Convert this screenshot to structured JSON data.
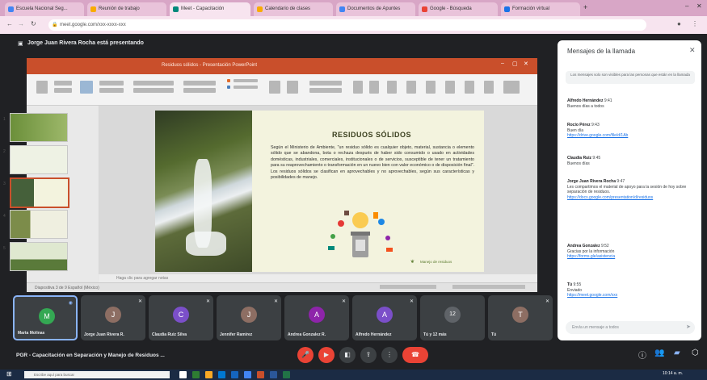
{
  "browser": {
    "tabs": [
      "Escuela Nacional Seg...",
      "Reunión de trabajo",
      "Meet - Capacitación",
      "Calendario de clases",
      "Documentos de Apuntes",
      "Google - Búsqueda",
      "Formación virtual"
    ],
    "url": "meet.google.com/xxx-xxxx-xxx"
  },
  "meet": {
    "presenter_label": "Jorge Juan Rivera Rocha está presentando",
    "meeting_name": "PGR - Capacitación en Separación y Manejo de Residuos ...",
    "participants": [
      {
        "name": "Marta Molinas",
        "initial": "M",
        "color": "#34a853"
      },
      {
        "name": "Jorge Juan Rivera R.",
        "initial": "J",
        "color": "#8d6e63"
      },
      {
        "name": "Claudia Ruiz Silva",
        "initial": "C",
        "color": "#7b4fc9"
      },
      {
        "name": "Jennifer Ramírez",
        "initial": "J",
        "color": "#8d6e63"
      },
      {
        "name": "Andrea Gonzalez R.",
        "initial": "A",
        "color": "#8e24aa"
      },
      {
        "name": "Alfredo Hernández",
        "initial": "A",
        "color": "#7b4fc9"
      },
      {
        "name": "Tú y 12 más",
        "initial": "12",
        "color": "#5f6368"
      },
      {
        "name": "Tú",
        "initial": "T",
        "color": "#8d6e63"
      }
    ]
  },
  "ppt": {
    "window_title": "Residuos sólidos - Presentación PowerPoint",
    "notes_placeholder": "Haga clic para agregar notas",
    "status": "Diapositiva 3 de 9   Español (México)",
    "slide_title": "RESIDUOS SÓLIDOS",
    "slide_body": "Según el Ministerio de Ambiente, \"un residuo sólido es cualquier objeto, material, sustancia o elemento sólido que se abandona, bota o rechaza después de haber sido consumido o usado en actividades domésticas, industriales, comerciales, institucionales o de servicios, susceptible de tener un tratamiento para su reaprovechamiento o transformación en un nuevo bien con valor económico o de disposición final\". Los residuos sólidos se clasifican en aprovechables y no aprovechables, según sus características y posibilidades de manejo.",
    "slide_footer": "Manejo de residuos"
  },
  "chat": {
    "title": "Mensajes de la llamada",
    "notice": "Los mensajes solo son visibles para las personas que están en la llamada",
    "messages": [
      {
        "who": "Alfredo Hernández",
        "time": "9:41",
        "text": "Buenos días a todos",
        "link": ""
      },
      {
        "who": "Rocío Pérez",
        "time": "9:43",
        "text": "Buen día",
        "link": "https://drive.google.com/file/d/1Ab"
      },
      {
        "who": "Claudia Ruiz",
        "time": "9:45",
        "text": "Buenos días",
        "link": ""
      },
      {
        "who": "Jorge Juan Rivera Rocha",
        "time": "9:47",
        "text": "Les compartimos el material de apoyo para la sesión de hoy sobre separación de residuos.",
        "link": "https://docs.google.com/presentation/d/residuos"
      },
      {
        "who": "Andrea Gonzalez",
        "time": "9:52",
        "text": "Gracias por la información",
        "link": "https://forms.gle/asistencia"
      },
      {
        "who": "Tú",
        "time": "9:55",
        "text": "Enviado",
        "link": "https://meet.google.com/xxx"
      }
    ],
    "input_placeholder": "Envía un mensaje a todos"
  },
  "taskbar": {
    "search_placeholder": "Escribe aquí para buscar",
    "time": "10:14 a. m."
  },
  "colors": {
    "ppt_accent": "#c94f2b",
    "meet_bg": "#202124",
    "end_call": "#ea4335",
    "link": "#1a73e8"
  }
}
